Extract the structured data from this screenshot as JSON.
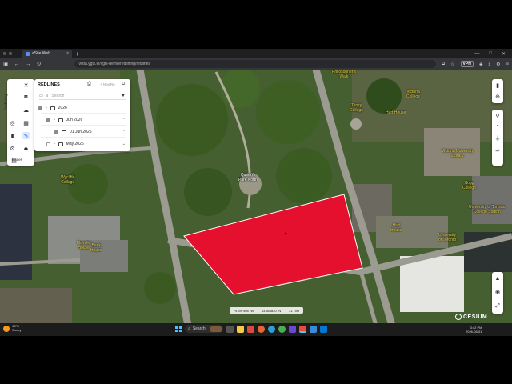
{
  "browser": {
    "tab_title": "aSite Web",
    "tab_close": "×",
    "new_tab": "+",
    "url": "vista.ygis.io/vgis-demo/redlining/redlines",
    "vpn": "VPN"
  },
  "map": {
    "labels": [
      {
        "text": "Philosopher's\nWalk",
        "color": "#f0d84a"
      },
      {
        "text": "Trinity\nCollege",
        "color": "#f0d84a"
      },
      {
        "text": "Queen's\nPark North",
        "color": "#ffffff"
      },
      {
        "text": "Wycliffe\nCollege",
        "color": "#f0d84a"
      },
      {
        "text": "Flavelle\nHouse",
        "color": "#f0d84a"
      },
      {
        "text": "Hart House",
        "color": "#f0d84a"
      },
      {
        "text": "Victoria\nCollege",
        "color": "#f0d84a"
      },
      {
        "text": "Hart\nHouse",
        "color": "#f0d84a"
      },
      {
        "text": "Victoria University\nLibrary",
        "color": "#f0d84a"
      },
      {
        "text": "University of Toronto\nCollege Station",
        "color": "#f0d84a"
      },
      {
        "text": "Hogg\nCollege",
        "color": "#f0d84a"
      },
      {
        "text": "University\nof Toronto",
        "color": "#f0d84a"
      },
      {
        "text": "Bank\nHouse",
        "color": "#f0d84a"
      }
    ],
    "polygon_color": "#e4102e",
    "coords": {
      "lon": "79.397408 °W",
      "lat": "43.665820 °N",
      "height": "71.75m"
    },
    "attribution": "CESIUM"
  },
  "toolstrip": {
    "vertical_label": "Redlining",
    "issues_label": "Issues",
    "icons": [
      "close-icon",
      "camera-icon",
      "cloud-icon",
      "target-icon",
      "layers-grid-icon",
      "bookmark-icon",
      "redline-icon",
      "settings-icon",
      "stack-icon"
    ]
  },
  "redlines": {
    "title": "REDLINES",
    "new_label": "+ NewRe",
    "search_placeholder": "Search",
    "tree": [
      {
        "label": "2026",
        "checked": true,
        "depth": 0
      },
      {
        "label": "Jun 2026",
        "checked": true,
        "depth": 1
      },
      {
        "label": "01 Jun 2026",
        "checked": true,
        "depth": 2
      },
      {
        "label": "May 2026",
        "checked": false,
        "depth": 1
      }
    ]
  },
  "right_controls": {
    "icons": [
      "pin-icon",
      "locate-icon",
      "marker-icon",
      "chevron-up-icon",
      "measure-icon",
      "share-icon",
      "compass-icon",
      "zoom-icon",
      "fullscreen-icon"
    ]
  },
  "taskbar": {
    "weather_temp": "18°C",
    "weather_desc": "Sunny",
    "search_label": "Search",
    "time": "3:42 PM",
    "date": "2026-06-01"
  }
}
